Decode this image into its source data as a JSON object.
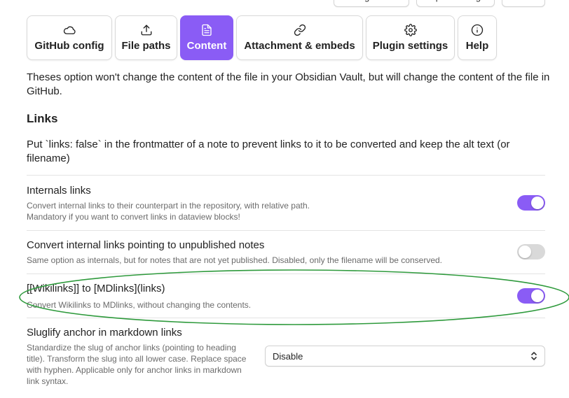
{
  "header_buttons": [
    {
      "label": "Export settings"
    },
    {
      "label": "Import settings"
    },
    {
      "label": "Presets"
    }
  ],
  "tabs": [
    {
      "label": "GitHub config",
      "icon": "cloud-icon",
      "active": false
    },
    {
      "label": "File paths",
      "icon": "upload-icon",
      "active": false
    },
    {
      "label": "Content",
      "icon": "file-text-icon",
      "active": true
    },
    {
      "label": "Attachment & embeds",
      "icon": "link-icon",
      "active": false
    },
    {
      "label": "Plugin settings",
      "icon": "gear-icon",
      "active": false
    },
    {
      "label": "Help",
      "icon": "info-icon",
      "active": false
    }
  ],
  "intro": "Theses option won't change the content of the file in your Obsidian Vault, but will change the content of the file in GitHub.",
  "links_section": {
    "heading": "Links",
    "description": "Put `links: false` in the frontmatter of a note to prevent links to it to be converted and keep the alt text (or filename)"
  },
  "settings": [
    {
      "title": "Internals links",
      "desc": [
        "Convert internal links to their counterpart in the repository, with relative path.",
        "Mandatory if you want to convert links in dataview blocks!"
      ],
      "toggle": true
    },
    {
      "title": "Convert internal links pointing to unpublished notes",
      "desc": [
        "Same option as internals, but for notes that are not yet published. Disabled, only the filename will be conserved."
      ],
      "toggle": false
    },
    {
      "title": "[[Wikilinks]] to [MDlinks](links)",
      "desc": [
        "Convert Wikilinks to MDlinks, without changing the contents."
      ],
      "toggle": true
    },
    {
      "title": "Sluglify anchor in markdown links",
      "desc": [
        "Standardize the slug of anchor links (pointing to heading",
        "title). Transform the slug into all lower case. Replace space",
        "with hyphen. Applicable only for anchor links in markdown",
        "link syntax."
      ],
      "select_value": "Disable"
    }
  ],
  "colors": {
    "accent": "#8a5cf5",
    "annotation": "#2e9a3c"
  }
}
